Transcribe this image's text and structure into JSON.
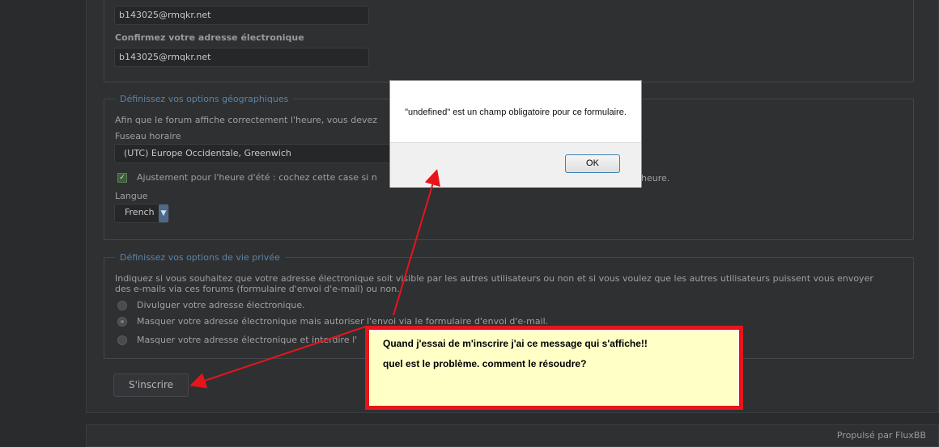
{
  "form": {
    "email_value": "b143025@rmqkr.net",
    "confirm_email_label": "Confirmez votre adresse électronique",
    "confirm_email_value": "b143025@rmqkr.net",
    "geo": {
      "legend": "Définissez vos options géographiques",
      "intro": "Afin que le forum affiche correctement l'heure, vous devez",
      "timezone_label": "Fuseau horaire",
      "timezone_value": "(UTC) Europe Occidentale, Greenwich",
      "dst_label_start": "Ajustement pour l'heure d'été : cochez cette case si n",
      "dst_label_end": "heure.",
      "language_label": "Langue",
      "language_value": "French"
    },
    "privacy": {
      "legend": "Définissez vos options de vie privée",
      "intro_line1": "Indiquez si vous souhaitez que votre adresse électronique soit visible par les autres utilisateurs ou non et si vous voulez que les autres utilisateurs puissent vous envoyer",
      "intro_line2": "des e-mails via ces forums (formulaire d'envoi d'e-mail) ou non.",
      "options": [
        "Divulguer votre adresse électronique.",
        "Masquer votre adresse électronique mais autoriser l'envoi via le formulaire d'envoi d'e-mail.",
        "Masquer votre adresse électronique et interdire l'"
      ]
    },
    "submit_label": "S'inscrire"
  },
  "alert": {
    "message": "\"undefined\" est un champ obligatoire pour ce formulaire.",
    "ok_label": "OK"
  },
  "annotation": {
    "line1": "Quand j'essai de m'inscrire j'ai ce message qui s'affiche!!",
    "line2": "quel est le problème. comment le résoudre?"
  },
  "footer": {
    "credit": "Propulsé par FluxBB"
  },
  "colors": {
    "annotation_red": "#e8141c",
    "note_background": "#ffffc6",
    "legend_blue": "#5c84a8"
  }
}
